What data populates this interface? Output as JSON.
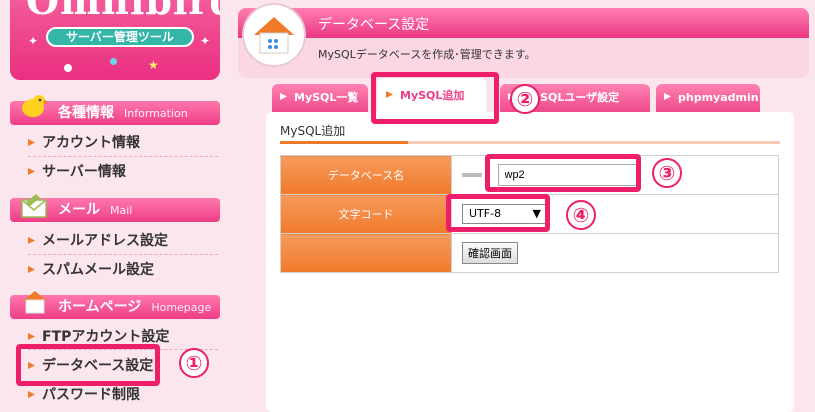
{
  "logo": {
    "text": "Omnibird",
    "tagline": "サーバー管理ツール"
  },
  "sidebar": {
    "sections": [
      {
        "title": "各種情報",
        "en": "Information",
        "icon": "bird-icon",
        "items": [
          "アカウント情報",
          "サーバー情報"
        ]
      },
      {
        "title": "メール",
        "en": "Mail",
        "icon": "mail-envelope-icon",
        "items": [
          "メールアドレス設定",
          "スパムメール設定"
        ]
      },
      {
        "title": "ホームページ",
        "en": "Homepage",
        "icon": "house-icon",
        "items": [
          "FTPアカウント設定",
          "データベース設定",
          "パスワード制限"
        ]
      }
    ]
  },
  "header": {
    "title": "データベース設定",
    "description": "MySQLデータベースを作成･管理できます。"
  },
  "tabs": [
    "MySQL一覧",
    "MySQL追加",
    "MySQLユーザ設定",
    "phpmyadmin"
  ],
  "panel": {
    "title": "MySQL追加"
  },
  "form": {
    "db_label": "データベース名",
    "db_prefix": "",
    "db_value": "wp2",
    "charset_label": "文字コード",
    "charset_value": "UTF-8",
    "confirm_button": "確認画面"
  },
  "annotations": [
    "①",
    "②",
    "③",
    "④"
  ],
  "colors": {
    "accent": "#ee3d86",
    "orange": "#f07a2a",
    "highlight": "#ee1e6a",
    "bg": "#fce6ee"
  }
}
